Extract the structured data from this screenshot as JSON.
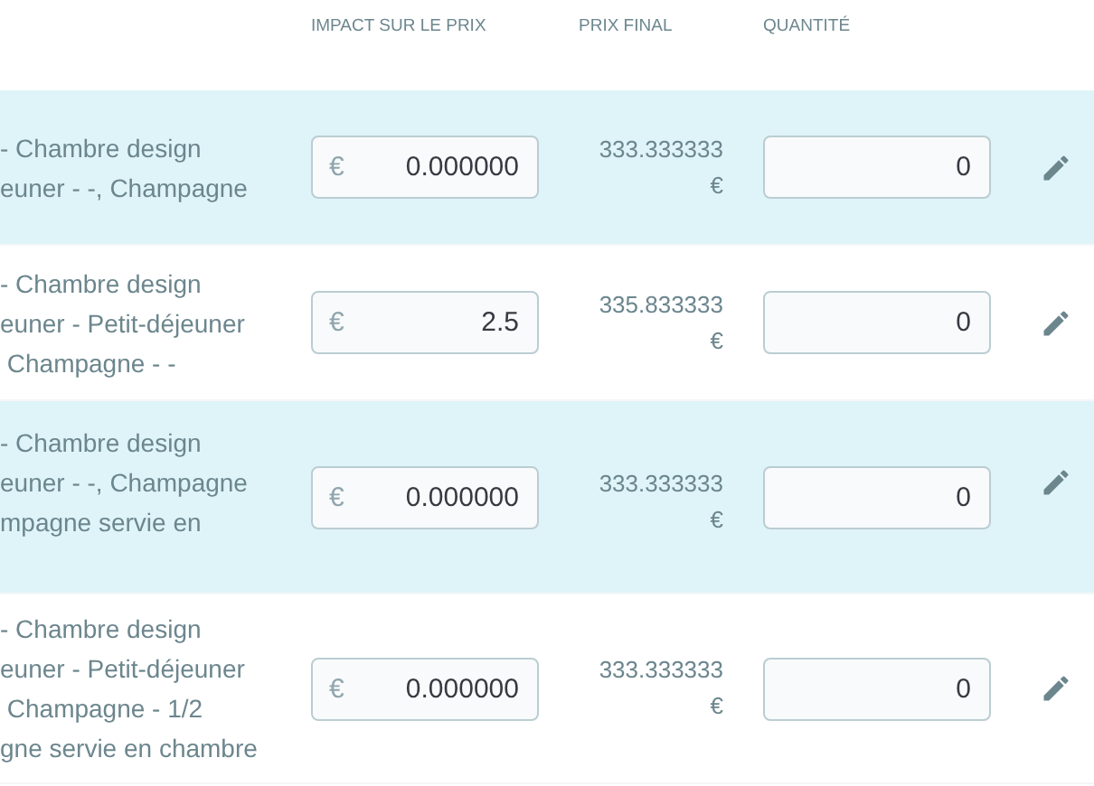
{
  "table": {
    "columns": [
      {
        "label": "IMPACT SUR LE PRIX"
      },
      {
        "label": "PRIX FINAL"
      },
      {
        "label": "QUANTITÉ"
      }
    ],
    "rows": [
      {
        "highlighted": true,
        "description": "- Chambre design\neuner - -, Champagne",
        "impact": "0.000000",
        "currency": "€",
        "final_price": "333.333333 €",
        "quantity": "0"
      },
      {
        "highlighted": false,
        "description": "- Chambre design\neuner - Petit-déjeuner\n Champagne - -",
        "impact": "2.5",
        "currency": "€",
        "final_price": "335.833333 €",
        "quantity": "0"
      },
      {
        "highlighted": true,
        "description": "- Chambre design\neuner - -, Champagne\nmpagne servie en",
        "impact": "0.000000",
        "currency": "€",
        "final_price": "333.333333 €",
        "quantity": "0"
      },
      {
        "highlighted": false,
        "description": "- Chambre design\neuner - Petit-déjeuner\n Champagne - 1/2\ngne servie en chambre",
        "impact": "0.000000",
        "currency": "€",
        "final_price": "333.333333 €",
        "quantity": "0"
      }
    ]
  }
}
